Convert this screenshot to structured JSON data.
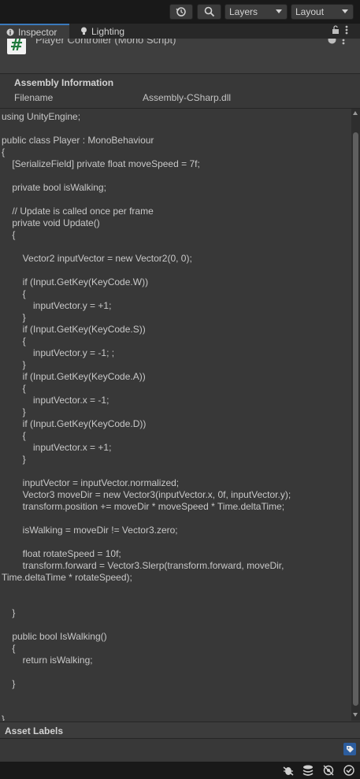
{
  "toolbar": {
    "history_icon": "history-icon",
    "search_icon": "search-icon",
    "layers": "Layers",
    "layout": "Layout"
  },
  "tabs": [
    {
      "label": "Inspector",
      "icon": "info-icon",
      "active": true
    },
    {
      "label": "Lighting",
      "icon": "lightbulb-icon",
      "active": false
    }
  ],
  "component": {
    "title": "Player Controller (Mono Script)"
  },
  "assembly": {
    "heading": "Assembly Information",
    "filename_label": "Filename",
    "filename_value": "Assembly-CSharp.dll"
  },
  "code_lines": [
    "using UnityEngine;",
    "",
    "public class Player : MonoBehaviour",
    "{",
    "    [SerializeField] private float moveSpeed = 7f;",
    "",
    "    private bool isWalking;",
    "",
    "    // Update is called once per frame",
    "    private void Update()",
    "    {",
    "",
    "        Vector2 inputVector = new Vector2(0, 0);",
    "",
    "        if (Input.GetKey(KeyCode.W))",
    "        {",
    "            inputVector.y = +1;",
    "        }",
    "        if (Input.GetKey(KeyCode.S))",
    "        {",
    "            inputVector.y = -1; ;",
    "        }",
    "        if (Input.GetKey(KeyCode.A))",
    "        {",
    "            inputVector.x = -1;",
    "        }",
    "        if (Input.GetKey(KeyCode.D))",
    "        {",
    "            inputVector.x = +1;",
    "        }",
    "",
    "        inputVector = inputVector.normalized;",
    "        Vector3 moveDir = new Vector3(inputVector.x, 0f, inputVector.y);",
    "        transform.position += moveDir * moveSpeed * Time.deltaTime;",
    "",
    "        isWalking = moveDir != Vector3.zero;",
    "",
    "        float rotateSpeed = 10f;",
    "        transform.forward = Vector3.Slerp(transform.forward, moveDir,",
    "Time.deltaTime * rotateSpeed);",
    "",
    "",
    "    }",
    "",
    "    public bool IsWalking()",
    "    {",
    "        return isWalking;",
    "",
    "    }",
    "",
    "",
    "}"
  ],
  "asset_labels": {
    "heading": "Asset Labels"
  }
}
